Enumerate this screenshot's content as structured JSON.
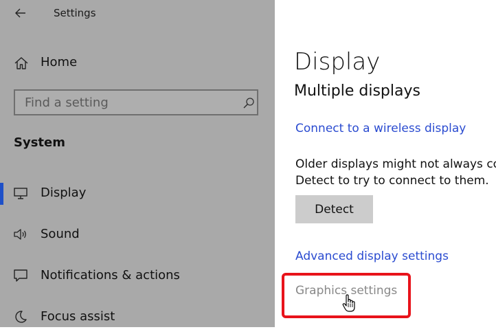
{
  "app": {
    "title": "Settings"
  },
  "sidebar": {
    "home_label": "Home",
    "search": {
      "placeholder": "Find a setting"
    },
    "section_heading": "System",
    "items": [
      {
        "label": "Display",
        "icon": "monitor-icon",
        "selected": true
      },
      {
        "label": "Sound",
        "icon": "speaker-icon",
        "selected": false
      },
      {
        "label": "Notifications & actions",
        "icon": "message-icon",
        "selected": false
      },
      {
        "label": "Focus assist",
        "icon": "moon-icon",
        "selected": false
      }
    ]
  },
  "content": {
    "title": "Display",
    "subsection": "Multiple displays",
    "wireless_link": "Connect to a wireless display",
    "description_line1": "Older displays might not always con",
    "description_line2": "Detect to try to connect to them.",
    "detect_button": "Detect",
    "advanced_link": "Advanced display settings",
    "graphics_link": "Graphics settings"
  },
  "colors": {
    "sidebar_bg": "#a9a9a9",
    "accent": "#1e50c8",
    "link": "#2a4bd0",
    "highlight": "#e8131b",
    "button_bg": "#cccccc"
  }
}
